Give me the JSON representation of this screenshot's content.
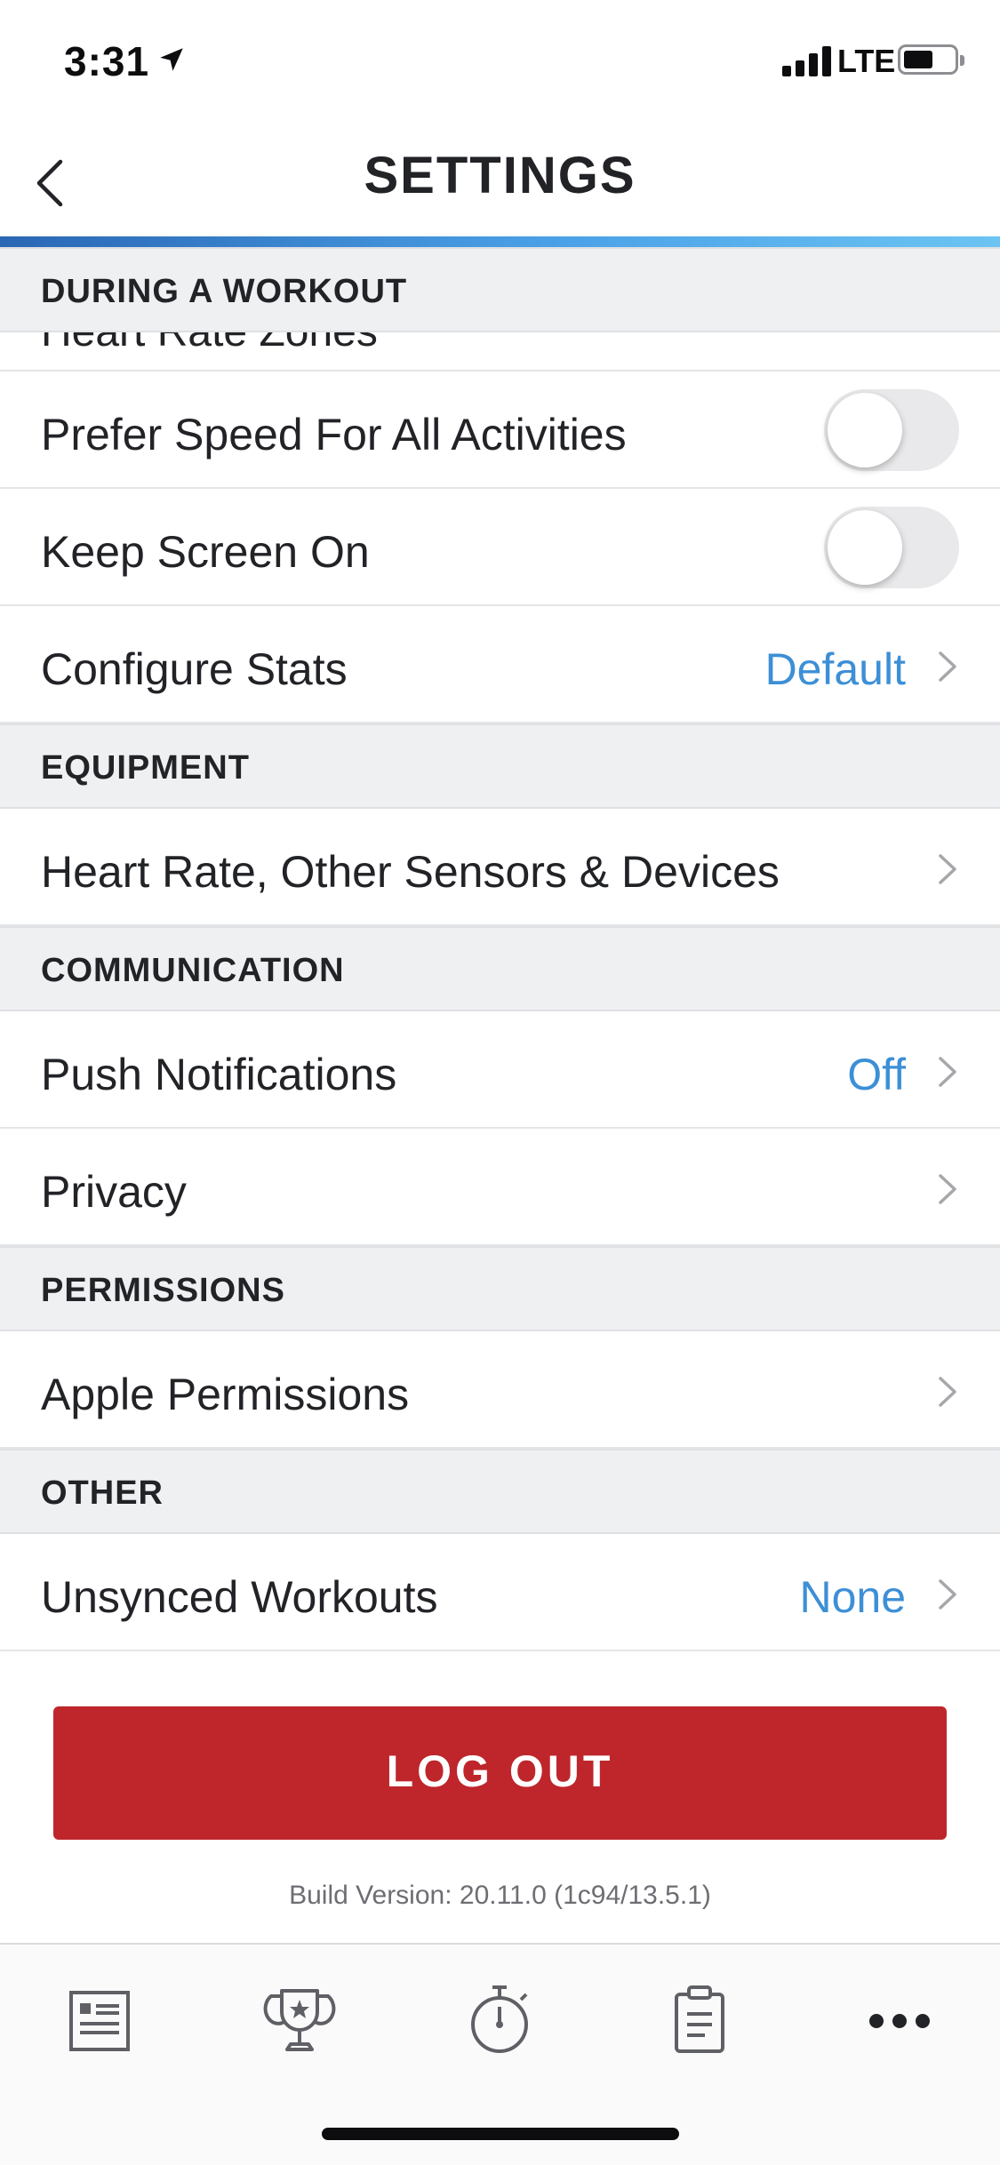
{
  "status_bar": {
    "time": "3:31",
    "network": "LTE"
  },
  "header": {
    "title": "SETTINGS",
    "back_icon": "chevron-left-icon"
  },
  "colors": {
    "accent": "#3d8fd6",
    "logout": "#be262b",
    "section_bg": "#eff0f2",
    "header_bar": "#4aa0e6"
  },
  "sections": {
    "during_workout": {
      "title": "DURING A WORKOUT",
      "clipped_item": "Heart Rate Zones",
      "prefer_speed": {
        "label": "Prefer Speed For All Activities",
        "on": false
      },
      "keep_screen_on": {
        "label": "Keep Screen On",
        "on": false
      },
      "configure_stats": {
        "label": "Configure Stats",
        "value": "Default"
      }
    },
    "equipment": {
      "title": "EQUIPMENT",
      "sensors": {
        "label": "Heart Rate, Other Sensors & Devices"
      }
    },
    "communication": {
      "title": "COMMUNICATION",
      "push": {
        "label": "Push Notifications",
        "value": "Off"
      },
      "privacy": {
        "label": "Privacy"
      }
    },
    "permissions": {
      "title": "PERMISSIONS",
      "apple": {
        "label": "Apple Permissions"
      }
    },
    "other": {
      "title": "OTHER",
      "unsynced": {
        "label": "Unsynced Workouts",
        "value": "None"
      }
    }
  },
  "logout": {
    "label": "LOG OUT"
  },
  "build_version": "Build Version: 20.11.0 (1c94/13.5.1)",
  "tab_bar": {
    "items": [
      "feed-icon",
      "trophy-icon",
      "stopwatch-icon",
      "clipboard-icon",
      "more-icon"
    ]
  }
}
